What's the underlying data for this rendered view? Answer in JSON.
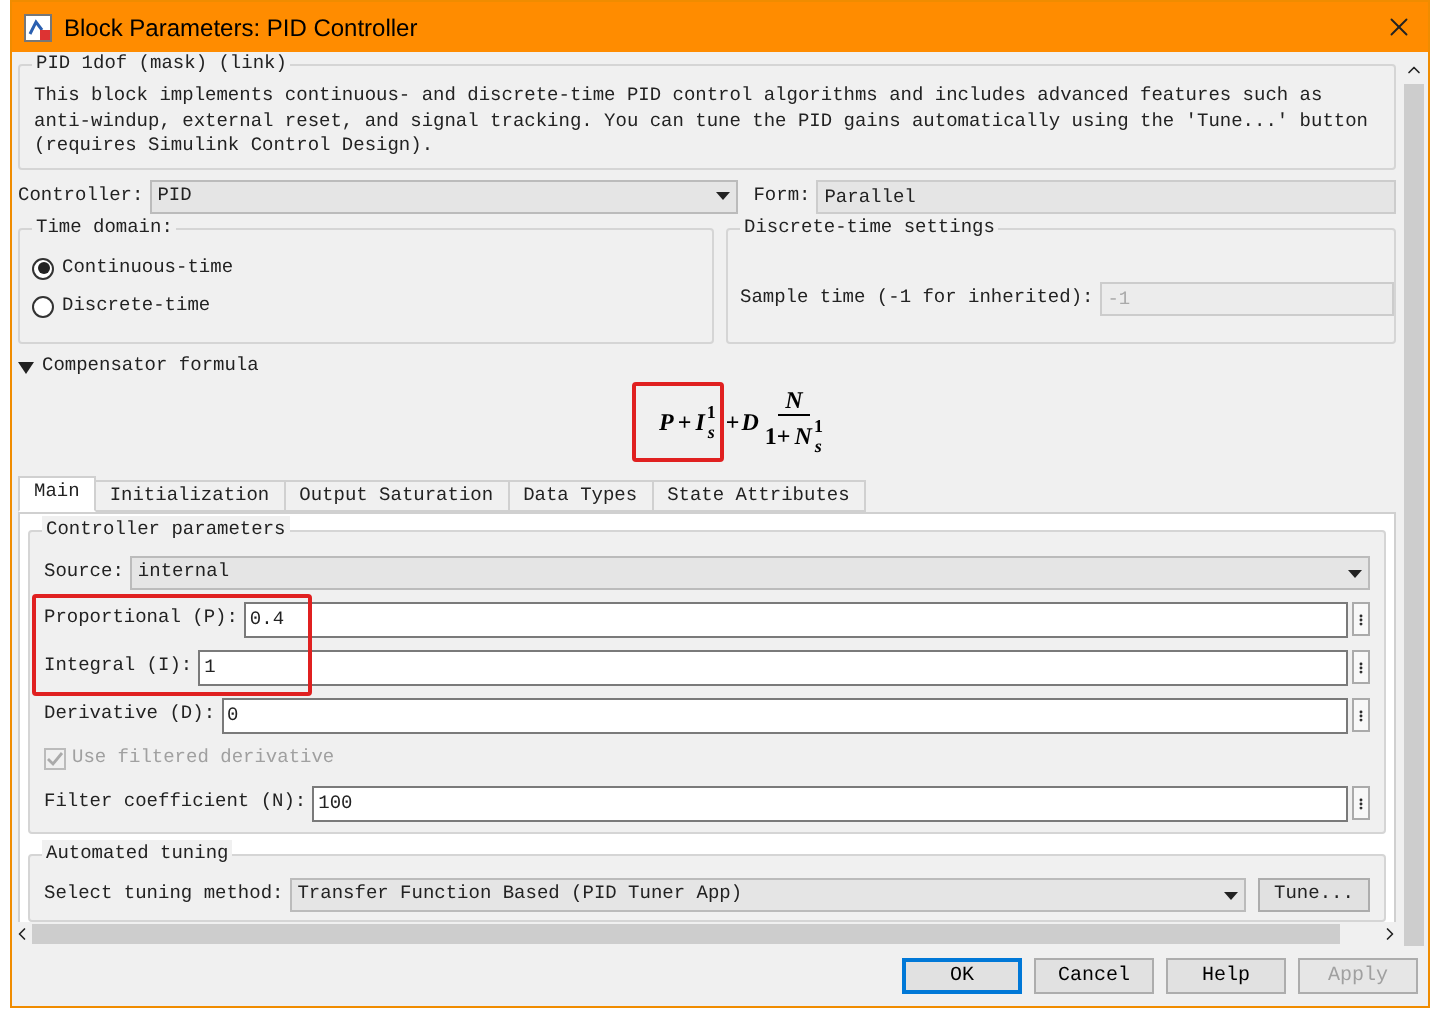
{
  "window": {
    "title": "Block Parameters: PID Controller"
  },
  "description_group": {
    "title": "PID 1dof (mask) (link)",
    "text": "This block implements continuous- and discrete-time PID control algorithms and includes advanced features such as anti-windup, external reset, and signal tracking. You can tune the PID gains automatically using the 'Tune...' button (requires Simulink Control Design)."
  },
  "controller": {
    "label": "Controller:",
    "value": "PID"
  },
  "form": {
    "label": "Form:",
    "value": "Parallel"
  },
  "time_domain": {
    "title": "Time domain:",
    "options": [
      {
        "label": "Continuous-time",
        "selected": true
      },
      {
        "label": "Discrete-time",
        "selected": false
      }
    ]
  },
  "discrete_settings": {
    "title": "Discrete-time settings",
    "sample_time": {
      "label": "Sample time (-1 for inherited):",
      "value": "-1",
      "disabled": true
    }
  },
  "compensator": {
    "label": "Compensator formula",
    "expanded": true,
    "highlighted": true,
    "formula": {
      "p": "P",
      "plus1": "+",
      "i": "I",
      "i_num": "1",
      "i_den": "s",
      "plus2": "+",
      "d": "D",
      "d_num": "N",
      "d_den": "1+",
      "d_den_n": "N",
      "d_den_num": "1",
      "d_den_den": "s"
    }
  },
  "tabs": [
    {
      "label": "Main",
      "selected": true
    },
    {
      "label": "Initialization",
      "selected": false
    },
    {
      "label": "Output Saturation",
      "selected": false
    },
    {
      "label": "Data Types",
      "selected": false
    },
    {
      "label": "State Attributes",
      "selected": false
    }
  ],
  "controller_parameters": {
    "title": "Controller parameters",
    "source": {
      "label": "Source:",
      "value": "internal"
    },
    "gains": {
      "highlighted": true,
      "rows": [
        {
          "kind": "field",
          "label": "Proportional (P):",
          "value": "0.4"
        },
        {
          "kind": "field",
          "label": "Integral (I):",
          "value": "1"
        }
      ]
    },
    "rows": [
      {
        "kind": "field",
        "label": "Derivative (D):",
        "value": "0"
      },
      {
        "kind": "checkbox",
        "label": "Use filtered derivative",
        "checked": true,
        "disabled": true
      },
      {
        "kind": "field",
        "label": "Filter coefficient (N):",
        "value": "100"
      }
    ]
  },
  "automated_tuning": {
    "title": "Automated tuning",
    "method_label": "Select tuning method:",
    "method_value": "Transfer Function Based (PID Tuner App)",
    "tune_button": "Tune..."
  },
  "buttons": [
    {
      "label": "OK",
      "default": true,
      "disabled": false
    },
    {
      "label": "Cancel",
      "default": false,
      "disabled": false
    },
    {
      "label": "Help",
      "default": false,
      "disabled": false
    },
    {
      "label": "Apply",
      "default": false,
      "disabled": true
    }
  ]
}
